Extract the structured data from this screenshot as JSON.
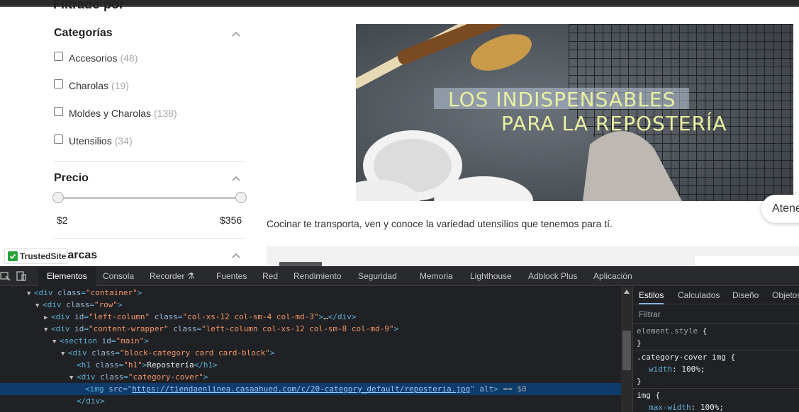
{
  "site": {
    "filter_heading": "Filtrado por",
    "categories": {
      "title": "Categorías",
      "items": [
        {
          "label": "Accesorios",
          "count": "(48)"
        },
        {
          "label": "Charolas",
          "count": "(19)"
        },
        {
          "label": "Moldes y Charolas",
          "count": "(138)"
        },
        {
          "label": "Utensilios",
          "count": "(34)"
        }
      ]
    },
    "price": {
      "title": "Precio",
      "min": "$2",
      "max": "$356",
      "range_fraction_low": 0,
      "range_fraction_high": 1
    },
    "brands": {
      "title": "Marcas"
    },
    "trusted_badge": "TrustedSite",
    "banner": {
      "line1": "LOS INDISPENSABLES",
      "line2": "PARA LA REPOSTERÍA"
    },
    "description": "Cocinar te transporta, ven y conoce la variedad utensilios que tenemos para tí.",
    "chat_bubble": "Atene"
  },
  "devtools": {
    "tabs": [
      "Elementos",
      "Consola",
      "Recorder",
      "Fuentes",
      "Red",
      "Rendimiento",
      "Seguridad",
      "Memoria",
      "Lighthouse",
      "Adblock Plus",
      "Aplicación"
    ],
    "active_tab": "Elementos",
    "dom": {
      "l1_tag": "div",
      "l1_attr": "class",
      "l1_val": "\"container\"",
      "l2_tag": "div",
      "l2_attr": "class",
      "l2_val": "\"row\"",
      "l3_tag": "div",
      "l3_attr1": "id",
      "l3_val1": "\"left-column\"",
      "l3_attr2": "class",
      "l3_val2": "\"col-xs-12 col-sm-4 col-md-3\"",
      "l3_ellipsis": "…",
      "l4_tag": "div",
      "l4_attr1": "id",
      "l4_val1": "\"content-wrapper\"",
      "l4_attr2": "class",
      "l4_val2": "\"left-column col-xs-12 col-sm-8 col-md-9\"",
      "l5_tag": "section",
      "l5_attr": "id",
      "l5_val": "\"main\"",
      "l6_tag": "div",
      "l6_attr": "class",
      "l6_val": "\"block-category card card-block\"",
      "l7_tag": "h1",
      "l7_attr": "class",
      "l7_val": "\"h1\"",
      "l7_text": "Repostería",
      "l8_tag": "div",
      "l8_attr": "class",
      "l8_val": "\"category-cover\"",
      "l9_tag": "img",
      "l9_attr1": "src",
      "l9_url": "https://tiendaenlinea.casaahued.com/c/20-category_default/reposteria.jpg",
      "l9_attr2": "alt",
      "l9_eq": "== $0",
      "l10_tag": "/div"
    },
    "styles": {
      "tabs": [
        "Estilos",
        "Calculados",
        "Diseño",
        "Objetos"
      ],
      "active_tab": "Estilos",
      "filter_placeholder": "Filtrar",
      "rule1_selector": "element.style",
      "rule2_selector": ".category-cover img",
      "rule2_prop": "width",
      "rule2_val": "100%;",
      "rule3_selector": "img",
      "rule3_prop": "max-width",
      "rule3_val": "100%;"
    }
  }
}
